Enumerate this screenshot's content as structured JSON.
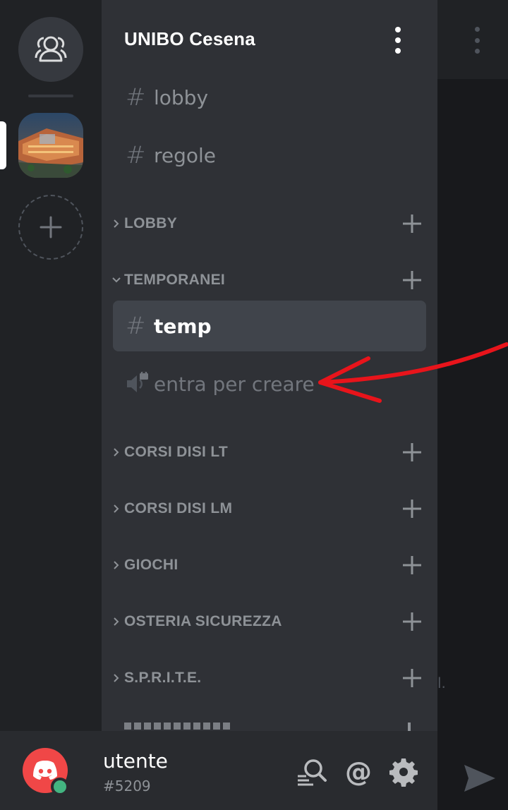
{
  "guild": {
    "name": "UNIBO Cesena"
  },
  "channels_top": [
    {
      "name": "lobby"
    },
    {
      "name": "regole"
    }
  ],
  "categories": {
    "lobby": {
      "name": "LOBBY"
    },
    "temporanei": {
      "name": "TEMPORANEI"
    },
    "corsi_lt": {
      "name": "CORSI DISI LT"
    },
    "corsi_lm": {
      "name": "CORSI DISI LM"
    },
    "giochi": {
      "name": "GIOCHI"
    },
    "osteria": {
      "name": "OSTERIA SICUREZZA"
    },
    "sprite": {
      "name": "S.P.R.I.T.E."
    }
  },
  "temp_channels": {
    "text": {
      "name": "temp"
    },
    "voice": {
      "name": "entra per creare"
    }
  },
  "chat": {
    "fragment": "l."
  },
  "user": {
    "name": "utente",
    "discriminator": "#5209",
    "status_color": "#43b581"
  },
  "colors": {
    "accent_red": "#f04747",
    "annotation": "#e8141b"
  },
  "icons": [
    "friends-icon",
    "add-server-icon",
    "kebab-icon",
    "hash-icon",
    "chevron-right-icon",
    "chevron-down-icon",
    "plus-icon",
    "locked-speaker-icon",
    "search-icon",
    "at-icon",
    "gear-icon",
    "send-icon",
    "discord-logo-icon"
  ]
}
